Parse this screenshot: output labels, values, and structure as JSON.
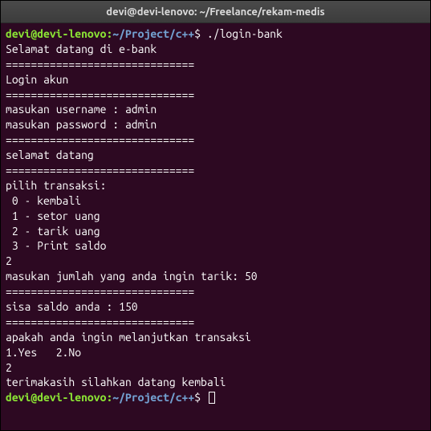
{
  "window": {
    "title": "devi@devi-lenovo: ~/Freelance/rekam-medis"
  },
  "prompt": {
    "userhost": "devi@devi-lenovo",
    "colon": ":",
    "path": "~/Project/c++",
    "dollar": "$"
  },
  "cmd1": "./login-bank",
  "lines": {
    "l01": "Selamat datang di e-bank",
    "l02": "==============================",
    "l03": "Login akun",
    "l04": "==============================",
    "l05": "masukan username : admin",
    "l06": "masukan password : admin",
    "l07": "==============================",
    "l08": "selamat datang",
    "l09": "==============================",
    "l10": "pilih transaksi:",
    "l11": " 0 - kembali",
    "l12": " 1 - setor uang",
    "l13": " 2 - tarik uang",
    "l14": " 3 - Print saldo",
    "l15": "2",
    "l16": "masukan jumlah yang anda ingin tarik: 50",
    "l17": "==============================",
    "l18": "sisa saldo anda : 150",
    "l19": "==============================",
    "l20": "apakah anda ingin melanjutkan transaksi",
    "l21": "1.Yes   2.No",
    "l22": "2",
    "l23": "terimakasih silahkan datang kembali"
  }
}
